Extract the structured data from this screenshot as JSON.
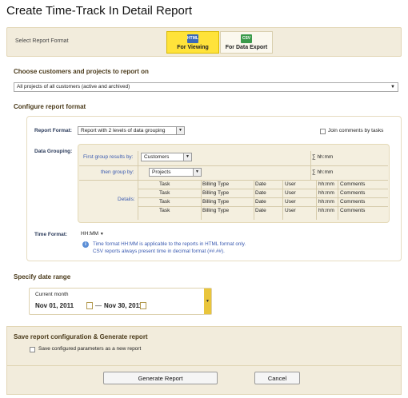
{
  "page_title": "Create Time-Track In Detail Report",
  "report_format": {
    "label": "Select Report Format",
    "options": [
      {
        "icon_text": "HTML",
        "label": "For Viewing",
        "selected": true
      },
      {
        "icon_text": "CSV",
        "label": "For Data Export",
        "selected": false
      }
    ]
  },
  "customers": {
    "heading": "Choose customers and projects to report on",
    "selected": "All projects of all customers (active and archived)"
  },
  "configure": {
    "heading": "Configure report format",
    "report_format_label": "Report Format:",
    "report_format_value": "Report with 2 levels of data grouping",
    "join_comments_label": "Join comments by tasks",
    "data_grouping_label": "Data Grouping:",
    "first_group_label": "First group results by:",
    "first_group_value": "Customers",
    "then_group_label": "then group by:",
    "then_group_value": "Projects",
    "sigma_label": "∑ hh:mm",
    "details_label": "Details:",
    "detail_columns": [
      [
        "Task",
        "Billing Type",
        "Date",
        "User",
        "hh:mm",
        "Comments"
      ],
      [
        "Task",
        "Billing Type",
        "Date",
        "User",
        "hh:mm",
        "Comments"
      ],
      [
        "Task",
        "Billing Type",
        "Date",
        "User",
        "hh:mm",
        "Comments"
      ],
      [
        "Task",
        "Billing Type",
        "Date",
        "User",
        "hh:mm",
        "Comments"
      ]
    ],
    "time_format_label": "Time Format:",
    "time_format_value": "HH:MM",
    "note_line1": "Time format HH:MM is applicable to the reports in HTML format only.",
    "note_line2": "CSV reports always present time in decimal format (##.##)."
  },
  "date_range": {
    "heading": "Specify date range",
    "preset": "Current month",
    "from": "Nov 01, 2011",
    "separator": "—",
    "to": "Nov 30, 2011"
  },
  "save": {
    "heading": "Save report configuration & Generate report",
    "checkbox_label": "Save configured parameters as a new report",
    "generate_button": "Generate Report",
    "cancel_button": "Cancel"
  },
  "colors": {
    "accent": "#ffe33a",
    "panel": "#f2ecdc",
    "link": "#3a5ab0"
  }
}
